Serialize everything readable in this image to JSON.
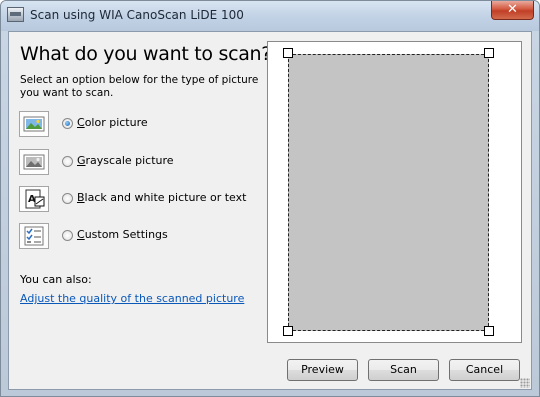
{
  "window": {
    "title": "Scan using WIA CanoScan LiDE 100",
    "close_glyph": "✕"
  },
  "main": {
    "heading": "What do you want to scan?",
    "instructions": "Select an option below for the type of picture you want to scan.",
    "options": [
      {
        "label": "Color picture",
        "icon": "color-picture-icon",
        "selected": true
      },
      {
        "label": "Grayscale picture",
        "icon": "grayscale-picture-icon",
        "selected": false
      },
      {
        "label": "Black and white picture or text",
        "icon": "black-white-text-icon",
        "selected": false
      },
      {
        "label": "Custom Settings",
        "icon": "custom-settings-icon",
        "selected": false
      }
    ],
    "also_label": "You can also:",
    "adjust_link": "Adjust the quality of the scanned picture"
  },
  "buttons": {
    "preview": "Preview",
    "scan": "Scan",
    "cancel": "Cancel"
  },
  "colors": {
    "link": "#0a58b8",
    "preview_area": "#c4c4c4",
    "close_button": "#c8442b"
  }
}
